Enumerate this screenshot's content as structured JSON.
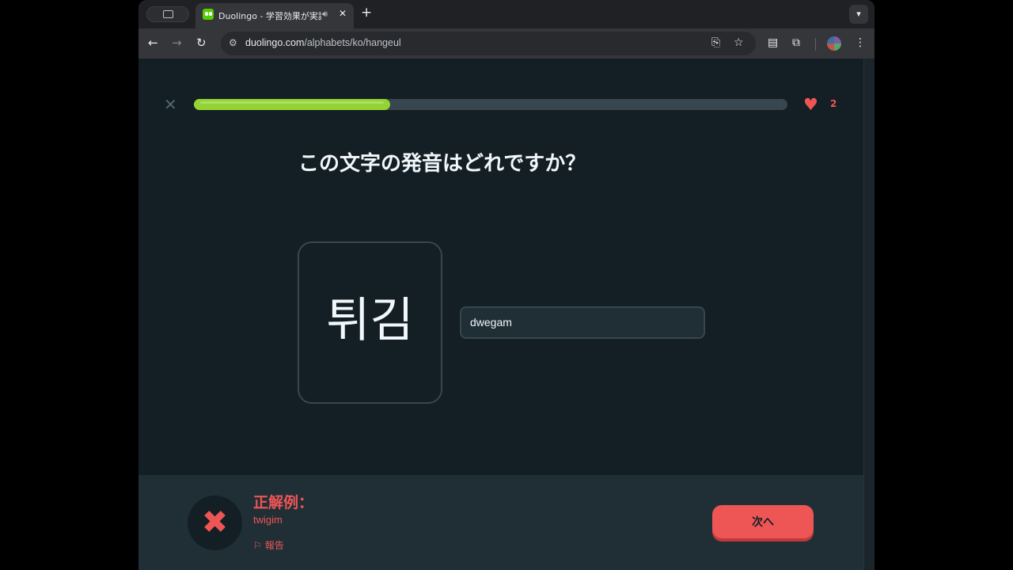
{
  "browser": {
    "tab_title": "Duolingo - 学習効果が実証されている",
    "tab_audio_icon": "speaker-icon",
    "tab_close": "✕",
    "new_tab": "+",
    "url_domain": "duolingo.com",
    "url_path": "/alphabets/ko/hangeul"
  },
  "lesson": {
    "progress": 0.33,
    "hearts": "2",
    "question": "この文字の発音はどれですか？",
    "character": "튀김",
    "answer_value": "dwegam"
  },
  "feedback": {
    "title": "正解例：",
    "correct_answer": "twigim",
    "report_label": "報告",
    "next_button": "次へ"
  },
  "colors": {
    "progress_fill": "#93d333",
    "error": "#ee5555",
    "page_bg": "#131f24"
  }
}
